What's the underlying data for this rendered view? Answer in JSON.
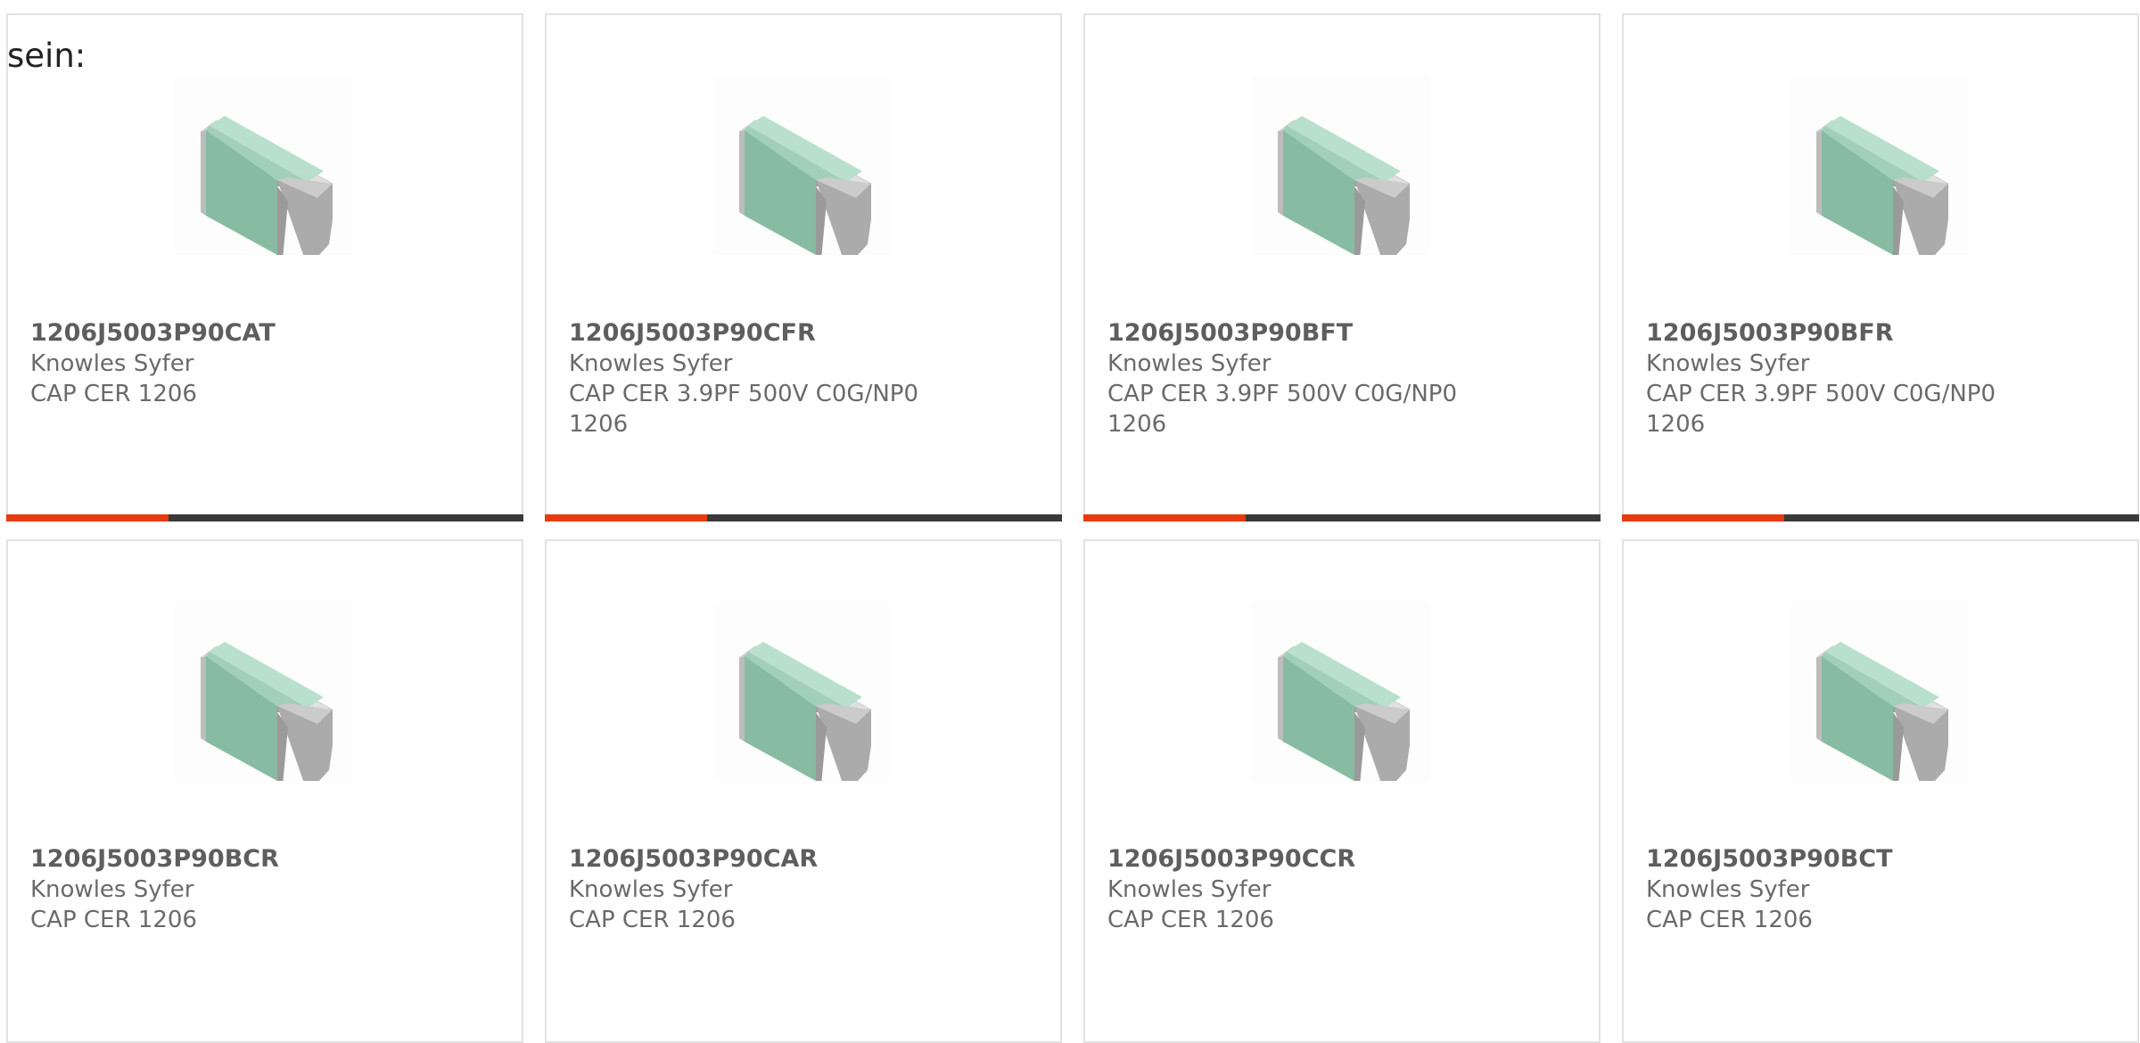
{
  "intro_text": "sein:",
  "colors": {
    "accent_bar": "#e63b0f",
    "bar_base": "#3a3a3a",
    "card_border": "#e2e2e2"
  },
  "products": [
    {
      "part_number": "1206J5003P90CAT",
      "manufacturer": "Knowles Syfer",
      "description": "CAP CER 1206",
      "image_icon": "ceramic-capacitor-chip-icon",
      "has_bar": true
    },
    {
      "part_number": "1206J5003P90CFR",
      "manufacturer": "Knowles Syfer",
      "description": "CAP CER 3.9PF 500V C0G/NP0 1206",
      "image_icon": "ceramic-capacitor-chip-icon",
      "has_bar": true
    },
    {
      "part_number": "1206J5003P90BFT",
      "manufacturer": "Knowles Syfer",
      "description": "CAP CER 3.9PF 500V C0G/NP0 1206",
      "image_icon": "ceramic-capacitor-chip-icon",
      "has_bar": true
    },
    {
      "part_number": "1206J5003P90BFR",
      "manufacturer": "Knowles Syfer",
      "description": "CAP CER 3.9PF 500V C0G/NP0 1206",
      "image_icon": "ceramic-capacitor-chip-icon",
      "has_bar": true
    },
    {
      "part_number": "1206J5003P90BCR",
      "manufacturer": "Knowles Syfer",
      "description": "CAP CER 1206",
      "image_icon": "ceramic-capacitor-chip-icon",
      "has_bar": false
    },
    {
      "part_number": "1206J5003P90CAR",
      "manufacturer": "Knowles Syfer",
      "description": "CAP CER 1206",
      "image_icon": "ceramic-capacitor-chip-icon",
      "has_bar": false
    },
    {
      "part_number": "1206J5003P90CCR",
      "manufacturer": "Knowles Syfer",
      "description": "CAP CER 1206",
      "image_icon": "ceramic-capacitor-chip-icon",
      "has_bar": false
    },
    {
      "part_number": "1206J5003P90BCT",
      "manufacturer": "Knowles Syfer",
      "description": "CAP CER 1206",
      "image_icon": "ceramic-capacitor-chip-icon",
      "has_bar": false
    }
  ]
}
